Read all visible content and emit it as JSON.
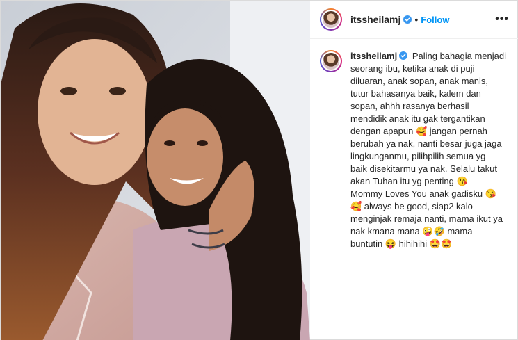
{
  "post": {
    "username": "itssheilamj",
    "follow_label": "Follow",
    "separator": "•",
    "more_label": "•••",
    "caption_lines": [
      "Paling bahagia menjadi",
      "seorang ibu, ketika anak di puji",
      "diluaran, anak sopan, anak manis,",
      "tutur bahasanya baik, kalem dan",
      "sopan, ahhh rasanya berhasil",
      "mendidik anak itu gak tergantikan",
      "dengan apapun 🥰 jangan pernah",
      "berubah ya nak, nanti besar juga jaga",
      "lingkunganmu, pilihpilih semua yg",
      "baik disekitarmu ya nak. Selalu takut",
      "akan Tuhan itu yg penting 😘",
      "Mommy Loves You anak gadisku 😘",
      "🥰 always be good, siap2 kalo",
      "menginjak remaja nanti, mama ikut ya",
      "nak kmana mana 🤪🤣 mama",
      "buntutin 😝 hihihihi 🤩🤩"
    ]
  },
  "colors": {
    "follow": "#0095f6",
    "verified": "#3897f0",
    "border": "#dbdbdb"
  },
  "icons": {
    "verified": "verified-badge-icon",
    "more": "more-options-icon"
  }
}
